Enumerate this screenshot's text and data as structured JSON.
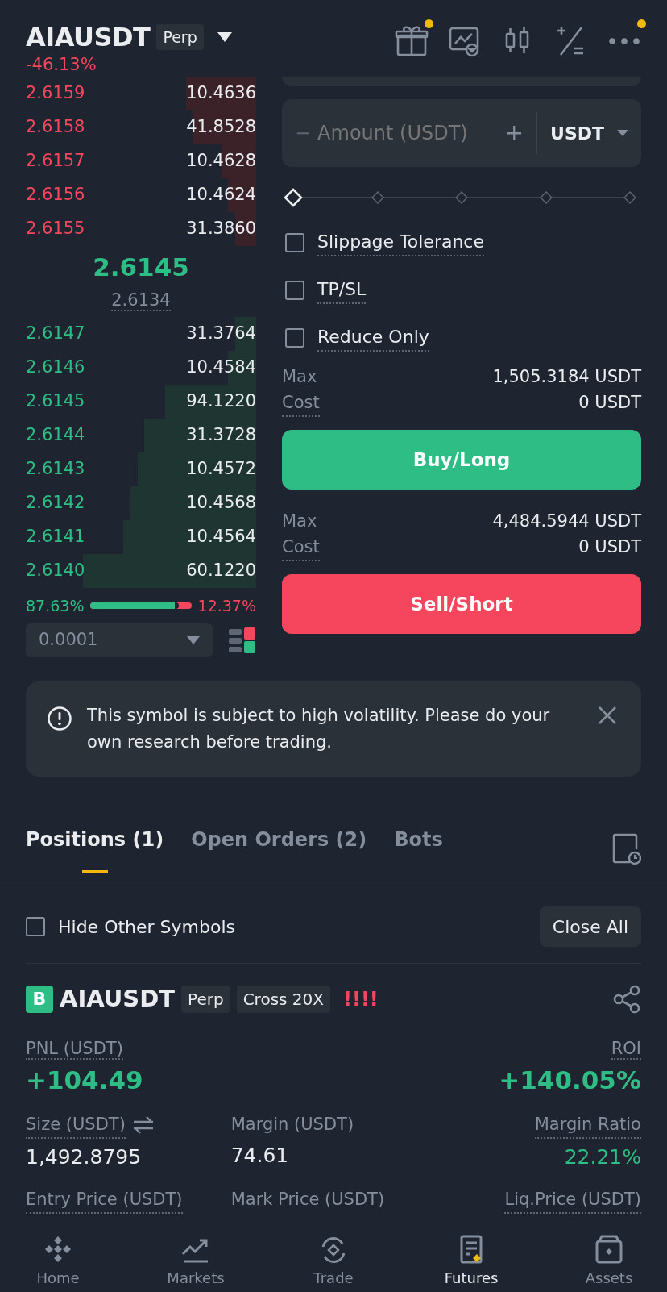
{
  "header": {
    "symbol": "AIAUSDT",
    "tag": "Perp",
    "change": "-46.13%",
    "icons": [
      {
        "kind": "gift",
        "dot": true
      },
      {
        "kind": "chart",
        "dot": false
      },
      {
        "kind": "candles",
        "dot": false
      },
      {
        "kind": "calc",
        "dot": false
      },
      {
        "kind": "more",
        "dot": true
      }
    ]
  },
  "orderbook": {
    "asks": [
      {
        "price": "2.6159",
        "qty": "10.4636"
      },
      {
        "price": "2.6158",
        "qty": "41.8528"
      },
      {
        "price": "2.6157",
        "qty": "10.4628"
      },
      {
        "price": "2.6156",
        "qty": "10.4624"
      },
      {
        "price": "2.6155",
        "qty": "31.3860"
      }
    ],
    "last_price": "2.6145",
    "mark_price": "2.6134",
    "bids": [
      {
        "price": "2.6147",
        "qty": "31.3764"
      },
      {
        "price": "2.6146",
        "qty": "10.4584"
      },
      {
        "price": "2.6145",
        "qty": "94.1220"
      },
      {
        "price": "2.6144",
        "qty": "31.3728"
      },
      {
        "price": "2.6143",
        "qty": "10.4572"
      },
      {
        "price": "2.6142",
        "qty": "10.4568"
      },
      {
        "price": "2.6141",
        "qty": "10.4564"
      },
      {
        "price": "2.6140",
        "qty": "60.1220"
      }
    ],
    "buy_share": "87.63%",
    "sell_share": "12.37%",
    "ratio": {
      "level": 0.8763
    },
    "precision": "0.0001"
  },
  "order_form": {
    "amount": {
      "minus": "−",
      "placeholder": "Amount (USDT)",
      "plus": "+",
      "unit": "USDT"
    },
    "slider": {
      "level": 0
    },
    "options": [
      {
        "label": "Slippage Tolerance",
        "checked": false
      },
      {
        "label": "TP/SL",
        "checked": false
      },
      {
        "label": "Reduce Only",
        "checked": false
      }
    ],
    "sides": [
      {
        "kind": "buy",
        "max_label": "Max",
        "max_value": "1,505.3184 USDT",
        "cost_label": "Cost",
        "cost_value": "0 USDT",
        "button": "Buy/Long"
      },
      {
        "kind": "sell",
        "max_label": "Max",
        "max_value": "4,484.5944 USDT",
        "cost_label": "Cost",
        "cost_value": "0 USDT",
        "button": "Sell/Short"
      }
    ]
  },
  "notice": {
    "text": "This symbol is subject to high volatility. Please do your own research before trading."
  },
  "tabs": [
    {
      "label": "Positions (1)",
      "selected": true
    },
    {
      "label": "Open Orders (2)",
      "selected": false
    },
    {
      "label": "Bots",
      "selected": false
    }
  ],
  "filter": {
    "label": "Hide Other Symbols",
    "checked": false,
    "button": "Close All"
  },
  "position": {
    "side": "B",
    "symbol": "AIAUSDT",
    "tags": [
      "Perp",
      "Cross 20X"
    ],
    "risk": "!!!!",
    "pnl_label": "PNL (USDT)",
    "pnl": "+104.49",
    "roi_label": "ROI",
    "roi": "+140.05%",
    "fields": [
      {
        "label": "Size (USDT)",
        "value": "1,492.8795",
        "swap": true
      },
      {
        "label": "Margin (USDT)",
        "value": "74.61"
      },
      {
        "label": "Margin Ratio",
        "value": "22.21%",
        "positive": true
      },
      {
        "label": "Entry Price (USDT)"
      },
      {
        "label": "Mark Price (USDT)"
      },
      {
        "label": "Liq.Price (USDT)"
      }
    ]
  },
  "nav": [
    {
      "kind": "home",
      "label": "Home",
      "selected": false
    },
    {
      "kind": "markets",
      "label": "Markets",
      "selected": false
    },
    {
      "kind": "trade",
      "label": "Trade",
      "selected": false
    },
    {
      "kind": "futures",
      "label": "Futures",
      "selected": true
    },
    {
      "kind": "assets",
      "label": "Assets",
      "selected": false
    }
  ]
}
